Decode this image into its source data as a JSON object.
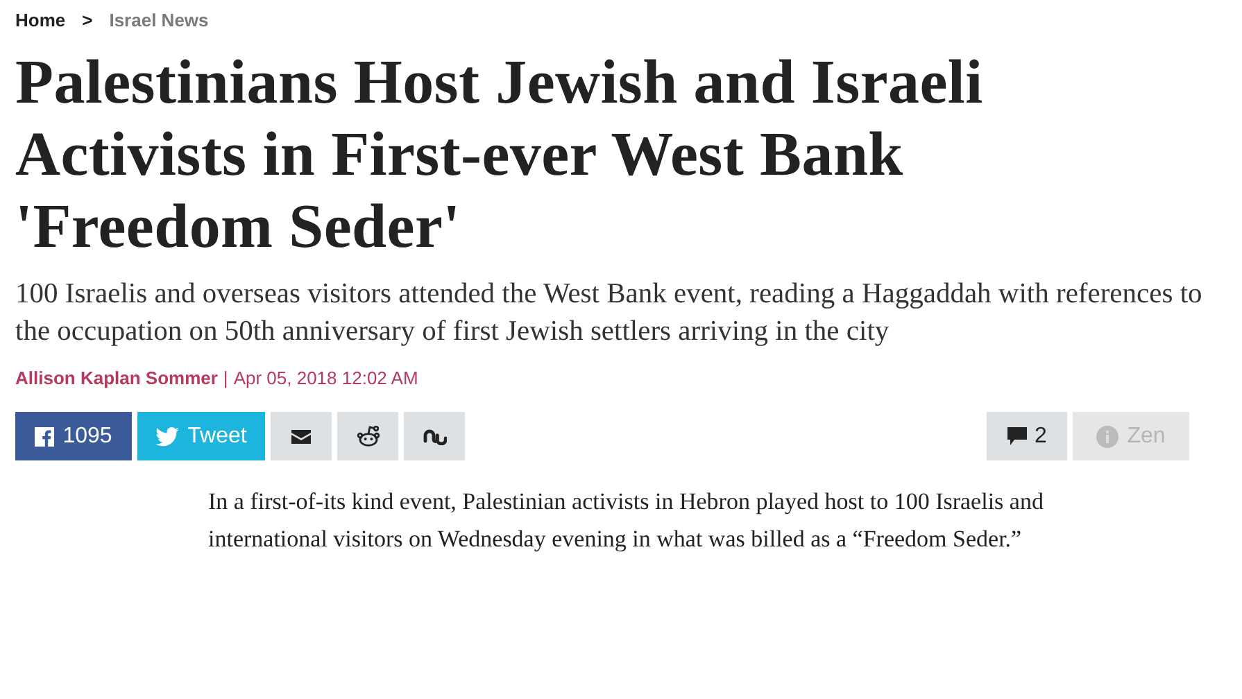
{
  "breadcrumb": [
    {
      "label": "Home",
      "selected": false
    },
    {
      "label": "Israel News",
      "selected": true
    }
  ],
  "breadcrumb_separator": ">",
  "headline": "Palestinians Host Jewish and Israeli Activists in First-ever West Bank 'Freedom Seder'",
  "subheadline": "100 Israelis and overseas visitors attended the West Bank event, reading a Haggaddah with references to the occupation on 50th anniversary of first Jewish settlers arriving in the city",
  "byline": {
    "author": "Allison Kaplan Sommer",
    "separator": "|",
    "date": "Apr 05, 2018 12:02 AM"
  },
  "share_buttons": [
    {
      "kind": "facebook",
      "label": "1095"
    },
    {
      "kind": "twitter",
      "label": "Tweet"
    },
    {
      "kind": "email"
    },
    {
      "kind": "reddit"
    },
    {
      "kind": "stumbleupon"
    }
  ],
  "tools": [
    {
      "kind": "comments",
      "label": "2",
      "disabled": false
    },
    {
      "kind": "zen",
      "label": "Zen",
      "disabled": true
    }
  ],
  "body": "In a first-of-its kind event, Palestinian activists in Hebron played host to 100 Israelis and international visitors on Wednesday evening in what was billed as a “Freedom Seder.”"
}
